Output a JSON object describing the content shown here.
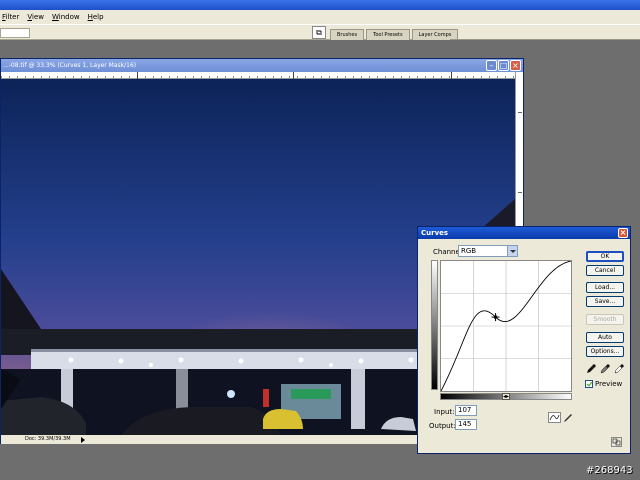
{
  "menu": [
    "Filter",
    "View",
    "Window",
    "Help"
  ],
  "panel_tabs": [
    "Brushes",
    "Tool Presets",
    "Layer Comps"
  ],
  "document": {
    "title": "...-08.tif @ 33.3% (Curves 1, Layer Mask/16)",
    "status": "Doc: 39.3M/39.3M",
    "ruler_labels": [
      "0",
      "2",
      "4"
    ]
  },
  "curves": {
    "title": "Curves",
    "channel_label": "Channel:",
    "channel_value": "RGB",
    "buttons": {
      "ok": "OK",
      "cancel": "Cancel",
      "load": "Load...",
      "save": "Save...",
      "smooth": "Smooth",
      "auto": "Auto",
      "options": "Options..."
    },
    "input_label": "Input:",
    "input_value": "107",
    "output_label": "Output:",
    "output_value": "145",
    "preview_label": "Preview",
    "preview_checked": true,
    "curve_points": [
      [
        0,
        0
      ],
      [
        107,
        145
      ],
      [
        255,
        255
      ]
    ]
  },
  "watermark": "#268943"
}
